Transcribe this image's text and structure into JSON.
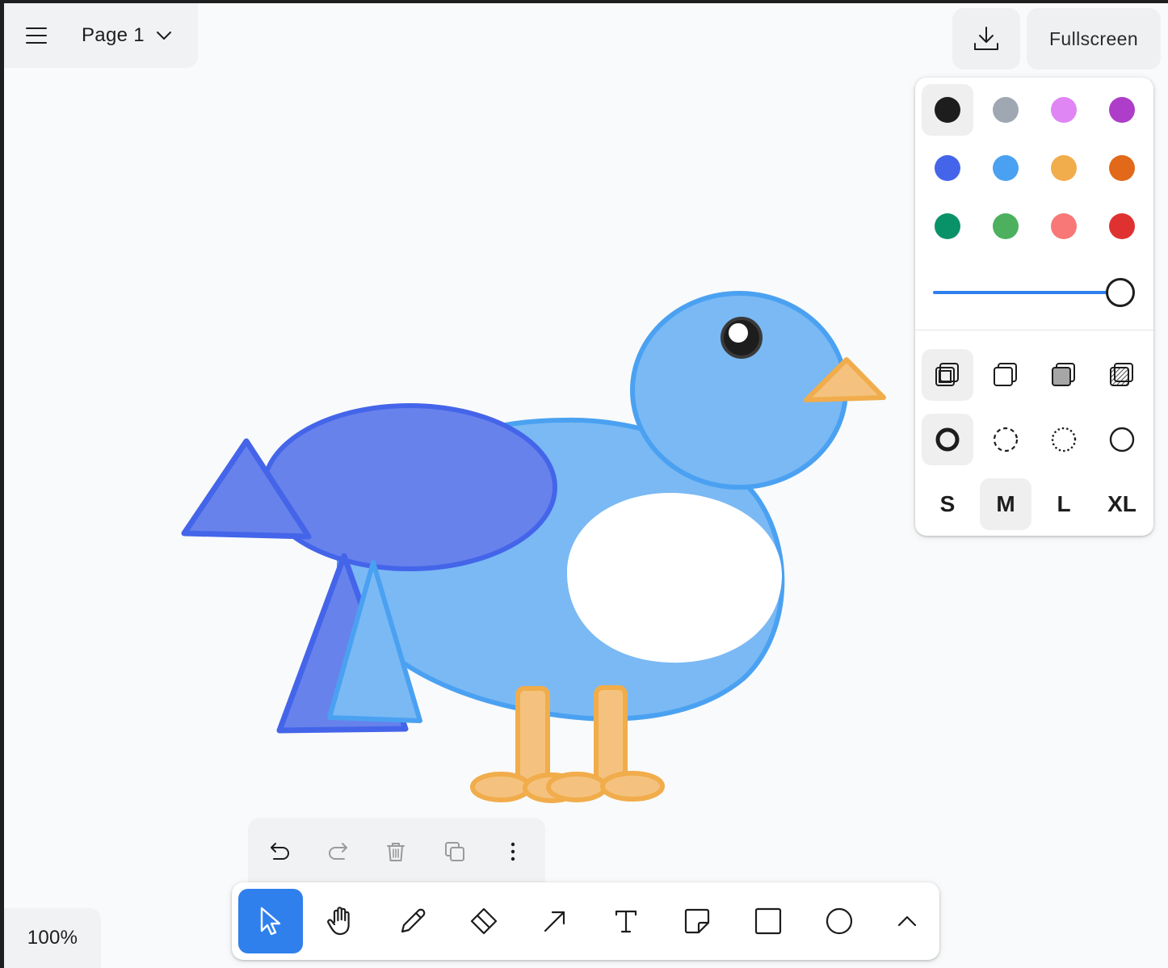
{
  "page_menu": {
    "page_label": "Page 1"
  },
  "top_bar": {
    "fullscreen_label": "Fullscreen"
  },
  "style_panel": {
    "colors": [
      {
        "name": "black",
        "hex": "#1d1d1d",
        "selected": true
      },
      {
        "name": "grey",
        "hex": "#9fa8b2",
        "selected": false
      },
      {
        "name": "light-violet",
        "hex": "#e085f4",
        "selected": false
      },
      {
        "name": "violet",
        "hex": "#ae3ec9",
        "selected": false
      },
      {
        "name": "blue",
        "hex": "#4465e9",
        "selected": false
      },
      {
        "name": "light-blue",
        "hex": "#4ba1f1",
        "selected": false
      },
      {
        "name": "yellow",
        "hex": "#f1ac4b",
        "selected": false
      },
      {
        "name": "orange",
        "hex": "#e16919",
        "selected": false
      },
      {
        "name": "green",
        "hex": "#099268",
        "selected": false
      },
      {
        "name": "light-green",
        "hex": "#4cb05e",
        "selected": false
      },
      {
        "name": "light-red",
        "hex": "#f87777",
        "selected": false
      },
      {
        "name": "red",
        "hex": "#e03131",
        "selected": false
      }
    ],
    "opacity": 1.0,
    "fill_options": [
      {
        "name": "fill-none",
        "selected": true
      },
      {
        "name": "fill-semi",
        "selected": false
      },
      {
        "name": "fill-solid",
        "selected": false
      },
      {
        "name": "fill-pattern",
        "selected": false
      }
    ],
    "dash_options": [
      {
        "name": "dash-draw",
        "selected": true
      },
      {
        "name": "dash-dashed",
        "selected": false
      },
      {
        "name": "dash-dotted",
        "selected": false
      },
      {
        "name": "dash-solid",
        "selected": false
      }
    ],
    "sizes": [
      {
        "label": "S",
        "selected": false
      },
      {
        "label": "M",
        "selected": true
      },
      {
        "label": "L",
        "selected": false
      },
      {
        "label": "XL",
        "selected": false
      }
    ]
  },
  "quick_actions": [
    "undo-icon",
    "redo-icon",
    "trash-icon",
    "duplicate-icon",
    "more-icon"
  ],
  "toolbar": {
    "tools": [
      {
        "name": "select",
        "icon": "cursor-icon",
        "active": true
      },
      {
        "name": "hand",
        "icon": "hand-icon",
        "active": false
      },
      {
        "name": "draw",
        "icon": "pencil-icon",
        "active": false
      },
      {
        "name": "eraser",
        "icon": "eraser-icon",
        "active": false
      },
      {
        "name": "arrow",
        "icon": "arrow-icon",
        "active": false
      },
      {
        "name": "text",
        "icon": "text-icon",
        "active": false
      },
      {
        "name": "note",
        "icon": "sticky-note-icon",
        "active": false
      },
      {
        "name": "rectangle",
        "icon": "rectangle-icon",
        "active": false
      },
      {
        "name": "ellipse",
        "icon": "ellipse-icon",
        "active": false
      },
      {
        "name": "more-tools",
        "icon": "chevron-up-icon",
        "active": false
      }
    ]
  },
  "zoom": {
    "label": "100%"
  },
  "canvas_colors": {
    "blue_stroke": "#4465e9",
    "blue_fill": "#6882ec",
    "light_blue_stroke": "#4ba1f1",
    "light_blue_fill": "#7ab9f4",
    "yellow_stroke": "#f1ac4b",
    "yellow_fill": "#f4c27e",
    "white": "#ffffff"
  }
}
